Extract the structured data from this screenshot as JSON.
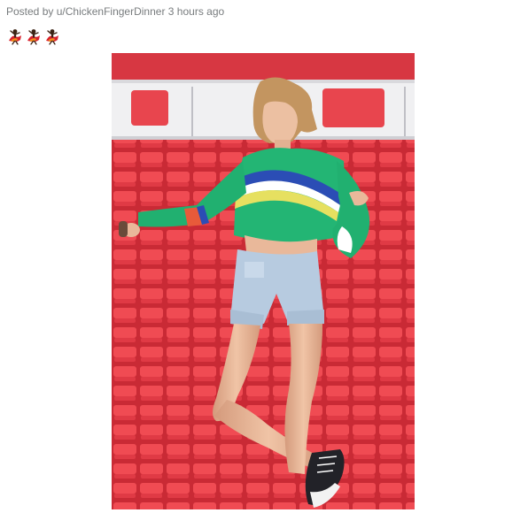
{
  "post": {
    "posted_by_prefix": "Posted by",
    "username": "u/ChickenFingerDinner",
    "time_ago": "3 hours ago"
  },
  "awards": [
    {
      "icon": "dancing-award-icon"
    },
    {
      "icon": "dancing-award-icon"
    },
    {
      "icon": "dancing-award-icon"
    }
  ],
  "media": {
    "type": "image",
    "colors": {
      "seat_red": "#e53a44",
      "seat_dark": "#b8202c",
      "sweater_green": "#22b573",
      "stripe_blue": "#2f4fb7",
      "stripe_yellow": "#e9e36a",
      "shorts_denim": "#b9cde0",
      "skin": "#e9b89a",
      "hair": "#c99a63"
    }
  }
}
